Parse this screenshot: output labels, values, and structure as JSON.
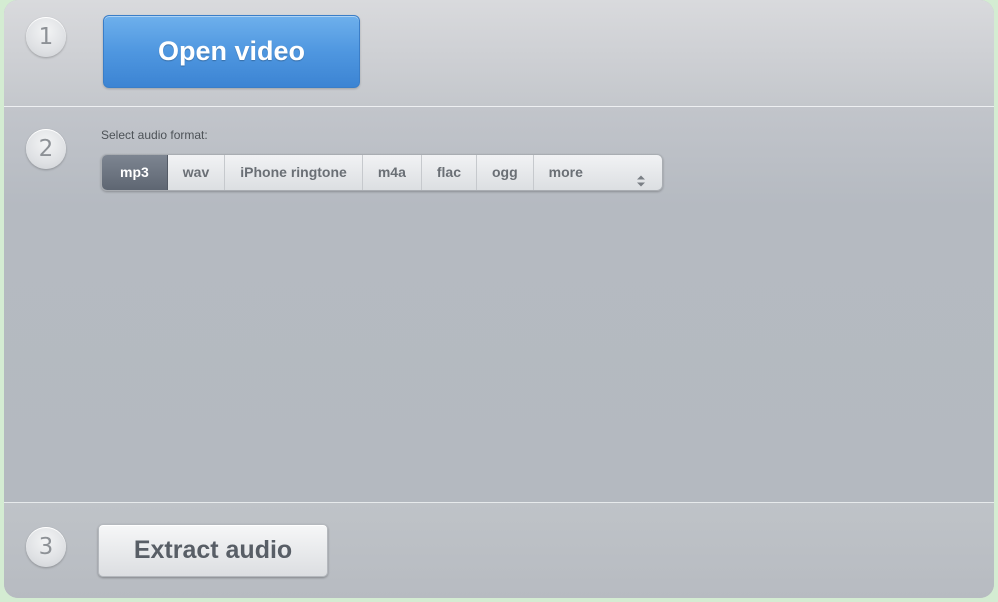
{
  "steps": {
    "one": "1",
    "two": "2",
    "three": "3"
  },
  "open_button": {
    "label": "Open video"
  },
  "format": {
    "label": "Select audio format:",
    "options": [
      "mp3",
      "wav",
      "iPhone ringtone",
      "m4a",
      "flac",
      "ogg",
      "more"
    ],
    "selected": "mp3"
  },
  "extract_button": {
    "label": "Extract audio"
  },
  "colors": {
    "accent": "#4f97e0",
    "selected_segment": "#6b7380",
    "background": "#b6bbc2"
  },
  "icons": {
    "more_dropdown": "up-down-arrows-icon"
  }
}
